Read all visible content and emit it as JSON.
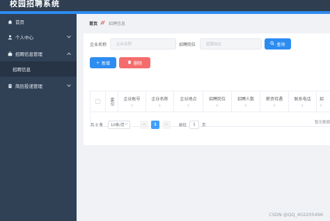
{
  "header": {
    "app_title": "校园招聘系统"
  },
  "sidebar": {
    "items": [
      {
        "label": "首页",
        "icon": "home-icon"
      },
      {
        "label": "个人中心",
        "icon": "user-icon"
      },
      {
        "label": "招聘信息管理",
        "icon": "briefcase-icon"
      },
      {
        "label": "招聘信息",
        "icon": ""
      },
      {
        "label": "简历投递管理",
        "icon": "document-icon"
      }
    ]
  },
  "breadcrumb": {
    "home": "首页",
    "current": "招聘信息"
  },
  "search": {
    "company_label": "企业名称",
    "company_placeholder": "企业名称",
    "position_label": "招聘岗位",
    "position_placeholder": "招聘岗位",
    "query_button": "查询"
  },
  "toolbar": {
    "add_button": "新增",
    "delete_button": "删除"
  },
  "table": {
    "columns": [
      "索引",
      "企业账号",
      "企业名称",
      "企业地点",
      "招聘岗位",
      "招聘人数",
      "薪资待遇",
      "联系电话",
      "招"
    ],
    "empty_text": "暂无数据"
  },
  "pagination": {
    "total_text": "共 0 条",
    "page_size": "10条/页",
    "prev": "<",
    "current_page": "1",
    "next": ">",
    "goto_label": "前往",
    "goto_value": "1",
    "page_suffix": "页"
  },
  "watermark": "CSDN @QQ_402205496",
  "colors": {
    "sidebar": "#304156",
    "accent": "#2d8cf0",
    "danger": "#f56c6c",
    "active_page": "#409eff"
  }
}
